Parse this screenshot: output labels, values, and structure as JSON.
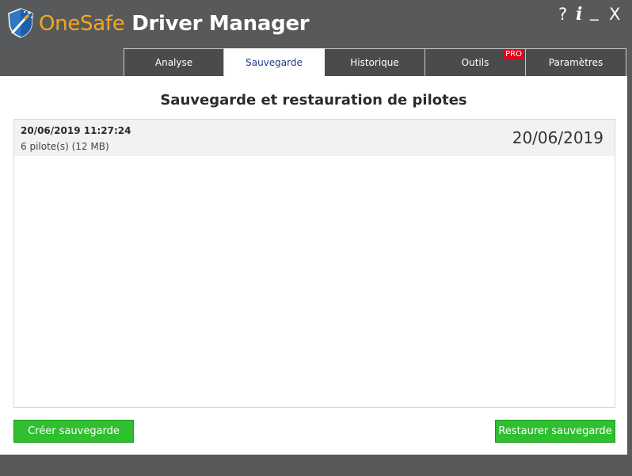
{
  "window": {
    "title_one": "One",
    "title_safe": "Safe",
    "title_rest": " Driver Manager",
    "controls": {
      "help": "?",
      "info": "i",
      "minimize": "_",
      "close": "X"
    }
  },
  "tabs": [
    {
      "label": "Analyse"
    },
    {
      "label": "Sauvegarde"
    },
    {
      "label": "Historique"
    },
    {
      "label": "Outils",
      "badge": "PRO"
    },
    {
      "label": "Paramètres"
    }
  ],
  "main": {
    "title": "Sauvegarde et restauration de pilotes",
    "backups": [
      {
        "datetime": "20/06/2019 11:27:24",
        "details": "6 pilote(s) (12 MB)",
        "date": "20/06/2019"
      }
    ],
    "buttons": {
      "create": "Créer sauvegarde",
      "restore": "Restaurer sauvegarde"
    }
  },
  "colors": {
    "accent": "#f5a71d",
    "titlebar": "#58595b",
    "button_green": "#2fbf2f",
    "pro_badge": "#e3001b",
    "active_tab_text": "#1f3a8a"
  },
  "icons": {
    "logo": "shield-wand-icon"
  }
}
